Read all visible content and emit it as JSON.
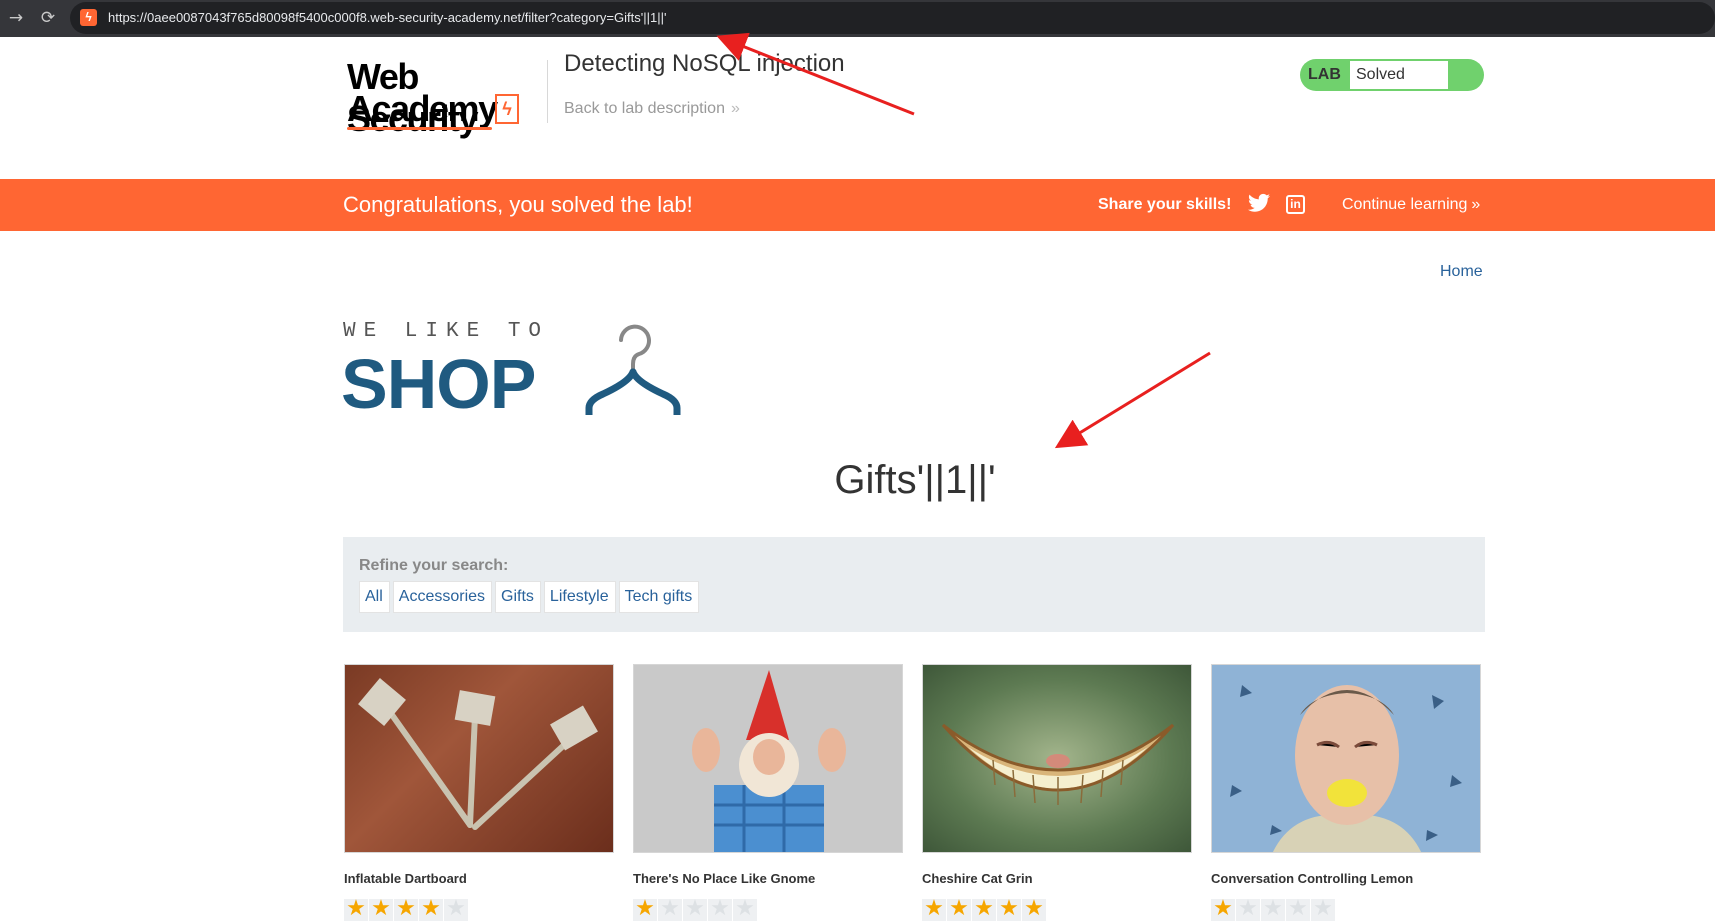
{
  "browser": {
    "back_icon": "→",
    "reload_icon": "⟳",
    "url": "https://0aee0087043f765d80098f5400c000f8.web-security-academy.net/filter?category=Gifts'||1||'"
  },
  "header": {
    "logo_line1": "Web Security",
    "logo_line2": "Academy",
    "lab_title": "Detecting NoSQL injection",
    "back_link": "Back to lab description",
    "back_chevron": "»",
    "lab_label": "LAB",
    "status": "Solved"
  },
  "banner": {
    "message": "Congratulations, you solved the lab!",
    "share": "Share your skills!",
    "continue": "Continue learning",
    "continue_chevron": "»",
    "color": "#ff6633"
  },
  "nav": {
    "home": "Home"
  },
  "shop_logo": {
    "tagline": "WE LIKE TO",
    "word": "SHOP"
  },
  "category_title": "Gifts'||1||'",
  "refine": {
    "label": "Refine your search:",
    "filters": [
      "All",
      "Accessories",
      "Gifts",
      "Lifestyle",
      "Tech gifts"
    ]
  },
  "products": [
    {
      "name": "Inflatable Dartboard",
      "rating": 4
    },
    {
      "name": "There's No Place Like Gnome",
      "rating": 1
    },
    {
      "name": "Cheshire Cat Grin",
      "rating": 5
    },
    {
      "name": "Conversation Controlling Lemon",
      "rating": 1
    }
  ],
  "colors": {
    "accent_orange": "#ff6633",
    "lab_green": "#70d16d",
    "link_blue": "#29629b",
    "shop_blue": "#1f5a80",
    "annotation_red": "#e8201f"
  }
}
